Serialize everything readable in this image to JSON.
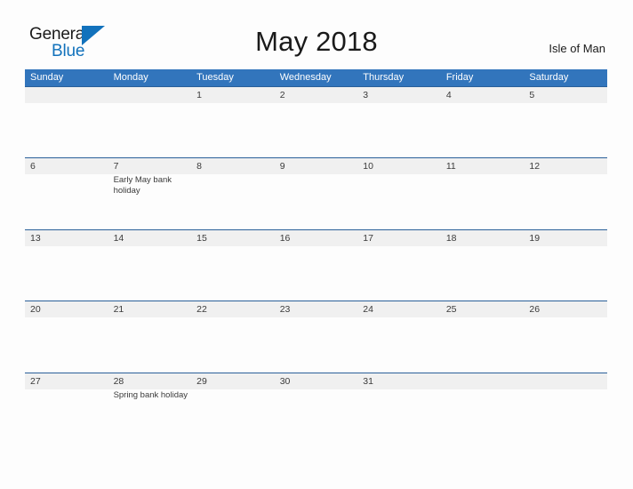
{
  "brand": {
    "name_part1": "General",
    "name_part2": "Blue",
    "mark_icon": "blue-triangle-flag-icon",
    "accent_color": "#1272bc"
  },
  "header": {
    "title": "May 2018",
    "region": "Isle of Man",
    "header_bar_color": "#3275bc",
    "row_divider_color": "#2a6099",
    "date_band_color": "#f0f0f0"
  },
  "calendar": {
    "month": "May",
    "year": "2018",
    "weekdays": [
      "Sunday",
      "Monday",
      "Tuesday",
      "Wednesday",
      "Thursday",
      "Friday",
      "Saturday"
    ],
    "weeks": [
      [
        {
          "day": "",
          "event": ""
        },
        {
          "day": "",
          "event": ""
        },
        {
          "day": "1",
          "event": ""
        },
        {
          "day": "2",
          "event": ""
        },
        {
          "day": "3",
          "event": ""
        },
        {
          "day": "4",
          "event": ""
        },
        {
          "day": "5",
          "event": ""
        }
      ],
      [
        {
          "day": "6",
          "event": ""
        },
        {
          "day": "7",
          "event": "Early May bank holiday"
        },
        {
          "day": "8",
          "event": ""
        },
        {
          "day": "9",
          "event": ""
        },
        {
          "day": "10",
          "event": ""
        },
        {
          "day": "11",
          "event": ""
        },
        {
          "day": "12",
          "event": ""
        }
      ],
      [
        {
          "day": "13",
          "event": ""
        },
        {
          "day": "14",
          "event": ""
        },
        {
          "day": "15",
          "event": ""
        },
        {
          "day": "16",
          "event": ""
        },
        {
          "day": "17",
          "event": ""
        },
        {
          "day": "18",
          "event": ""
        },
        {
          "day": "19",
          "event": ""
        }
      ],
      [
        {
          "day": "20",
          "event": ""
        },
        {
          "day": "21",
          "event": ""
        },
        {
          "day": "22",
          "event": ""
        },
        {
          "day": "23",
          "event": ""
        },
        {
          "day": "24",
          "event": ""
        },
        {
          "day": "25",
          "event": ""
        },
        {
          "day": "26",
          "event": ""
        }
      ],
      [
        {
          "day": "27",
          "event": ""
        },
        {
          "day": "28",
          "event": "Spring bank holiday"
        },
        {
          "day": "29",
          "event": ""
        },
        {
          "day": "30",
          "event": ""
        },
        {
          "day": "31",
          "event": ""
        },
        {
          "day": "",
          "event": ""
        },
        {
          "day": "",
          "event": ""
        }
      ]
    ]
  }
}
